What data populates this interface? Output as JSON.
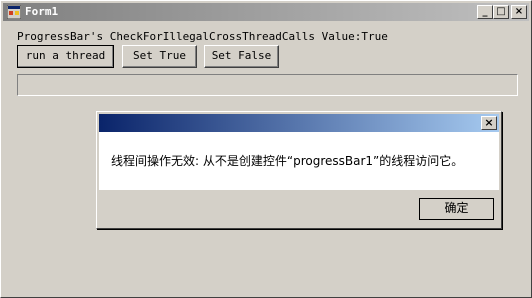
{
  "window": {
    "title": "Form1",
    "minimize_glyph": "_",
    "maximize_glyph": "□",
    "close_glyph": "×"
  },
  "main": {
    "status_text": "ProgressBar's CheckForIllegalCrossThreadCalls Value:True",
    "buttons": [
      {
        "label": "run a thread"
      },
      {
        "label": "Set True"
      },
      {
        "label": "Set False"
      }
    ],
    "progress_value": 0
  },
  "dialog": {
    "title": "",
    "close_glyph": "×",
    "message": "线程间操作无效: 从不是创建控件“progressBar1”的线程访问它。",
    "ok_label": "确定"
  },
  "colors": {
    "window_bg": "#d4d0c8",
    "inactive_title_start": "#808080",
    "active_title_start": "#0a246a",
    "active_title_end": "#a6caf0"
  },
  "icons": {
    "app_icon": "form-app-icon",
    "close": "close-icon"
  }
}
